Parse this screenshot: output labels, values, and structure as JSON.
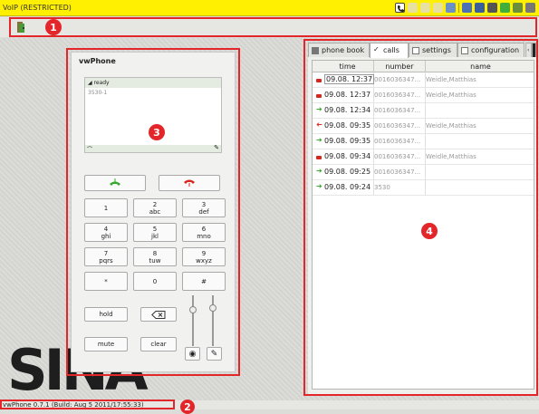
{
  "window": {
    "title": "VoIP (RESTRICTED)"
  },
  "tray": {
    "icons": [
      "phone-icon",
      "monitor-icon",
      "network-icon",
      "update-icon",
      "settings-icon",
      "security-icon",
      "pen-icon",
      "printer-icon"
    ]
  },
  "badges": [
    "1",
    "2",
    "3",
    "4"
  ],
  "phone": {
    "title": "vwPhone",
    "display": {
      "status": "ready",
      "number": "3530-1"
    },
    "keypad": [
      {
        "main": "1",
        "sub": ""
      },
      {
        "main": "2",
        "sub": "abc"
      },
      {
        "main": "3",
        "sub": "def"
      },
      {
        "main": "4",
        "sub": "ghi"
      },
      {
        "main": "5",
        "sub": "jkl"
      },
      {
        "main": "6",
        "sub": "mno"
      },
      {
        "main": "7",
        "sub": "pqrs"
      },
      {
        "main": "8",
        "sub": "tuw"
      },
      {
        "main": "9",
        "sub": "wxyz"
      },
      {
        "main": "*",
        "sub": ""
      },
      {
        "main": "0",
        "sub": ""
      },
      {
        "main": "#",
        "sub": ""
      }
    ],
    "hold_label": "hold",
    "mute_label": "mute",
    "clear_label": "clear"
  },
  "tabs": [
    {
      "label": "phone book",
      "active": false
    },
    {
      "label": "calls",
      "active": true
    },
    {
      "label": "settings",
      "active": false
    },
    {
      "label": "configuration",
      "active": false
    }
  ],
  "calls": {
    "columns": [
      "time",
      "number",
      "name"
    ],
    "rows": [
      {
        "type": "missed",
        "time": "09.08. 12:37",
        "number": "0016036347...",
        "name": "Weidle,Matthias"
      },
      {
        "type": "missed",
        "time": "09.08. 12:37",
        "number": "0016036347...",
        "name": "Weidle,Matthias"
      },
      {
        "type": "incoming",
        "time": "09.08. 12:34",
        "number": "0016036347...",
        "name": ""
      },
      {
        "type": "outgoing",
        "time": "09.08. 09:35",
        "number": "0016036347...",
        "name": "Weidle,Matthias"
      },
      {
        "type": "incoming",
        "time": "09.08. 09:35",
        "number": "0016036347...",
        "name": ""
      },
      {
        "type": "missed",
        "time": "09.08. 09:34",
        "number": "0016036347...",
        "name": "Weidle,Matthias"
      },
      {
        "type": "incoming",
        "time": "09.08. 09:25",
        "number": "0016036347...",
        "name": ""
      },
      {
        "type": "incoming",
        "time": "09.08. 09:24",
        "number": "3530",
        "name": ""
      }
    ]
  },
  "colors": {
    "accent_red": "#e2262a",
    "titlebar_yellow": "#ffef00",
    "incoming": "#36a82b",
    "outgoing": "#d7261e"
  },
  "statusbar": {
    "text": "vwPhone 0.7.1 (Build: Aug  5 2011/17:55:33)"
  }
}
